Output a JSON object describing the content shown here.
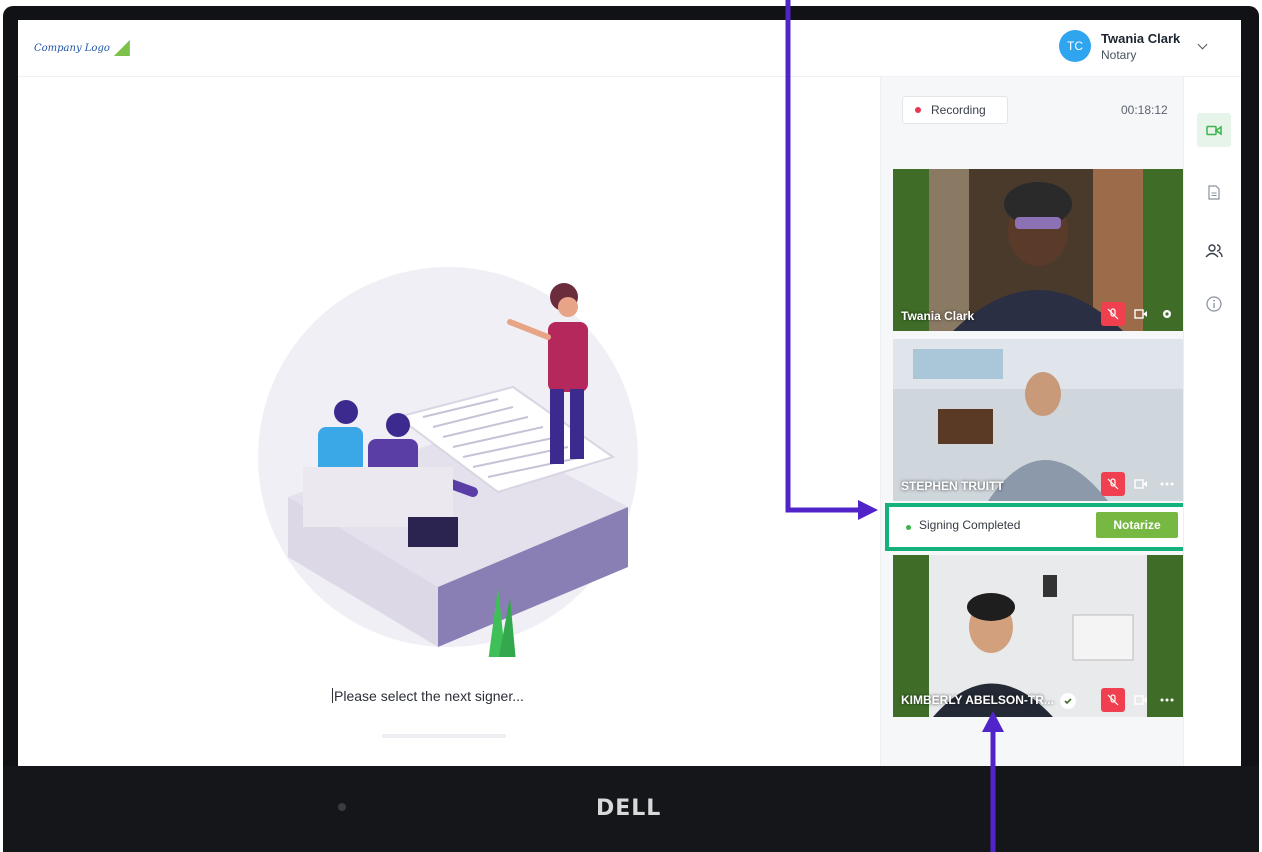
{
  "header": {
    "logo_text": "Company Logo",
    "user": {
      "initials": "TC",
      "name": "Twania Clark",
      "role": "Notary"
    }
  },
  "main": {
    "prompt": "Please select the next signer..."
  },
  "panel": {
    "recording_label": "Recording",
    "timer": "00:18:12",
    "participants": [
      {
        "name": "Twania Clark"
      },
      {
        "name": "STEPHEN TRUITT"
      },
      {
        "name": "KIMBERLY ABELSON-TR..."
      }
    ],
    "signing_status": "Signing Completed",
    "notarize_label": "Notarize"
  },
  "device": {
    "brand": "DELL"
  },
  "colors": {
    "accent_green": "#77b843",
    "highlight_border": "#14b27a",
    "annotation_arrow": "#5124c9",
    "mute_red": "#f0404f",
    "avatar_blue": "#2fa5f0"
  },
  "icons": [
    "video-camera-icon",
    "document-icon",
    "participants-icon",
    "info-icon",
    "mic-muted-icon",
    "camera-icon",
    "gear-icon",
    "more-icon",
    "verified-check-icon",
    "chevron-down-icon"
  ]
}
